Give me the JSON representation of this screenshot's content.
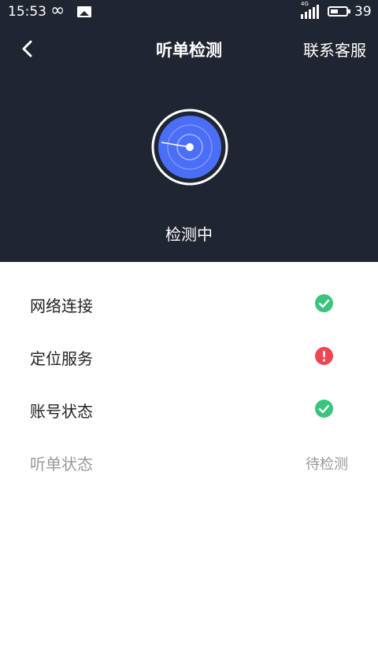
{
  "status_bar": {
    "time": "15:53",
    "network_tag": "4G",
    "battery_level": "39"
  },
  "header": {
    "title": "听单检测",
    "contact_label": "联系客服",
    "back_icon": "chevron-left-icon"
  },
  "detection": {
    "status": "检测中",
    "radar_color": "#4a6ef5"
  },
  "checks": [
    {
      "label": "网络连接",
      "state": "ok",
      "icon": "check-circle-icon",
      "color": "#3ac47d"
    },
    {
      "label": "定位服务",
      "state": "error",
      "icon": "exclamation-circle-icon",
      "color": "#f04654"
    },
    {
      "label": "账号状态",
      "state": "ok",
      "icon": "check-circle-icon",
      "color": "#3ac47d"
    },
    {
      "label": "听单状态",
      "state": "pending",
      "value": "待检测"
    }
  ]
}
